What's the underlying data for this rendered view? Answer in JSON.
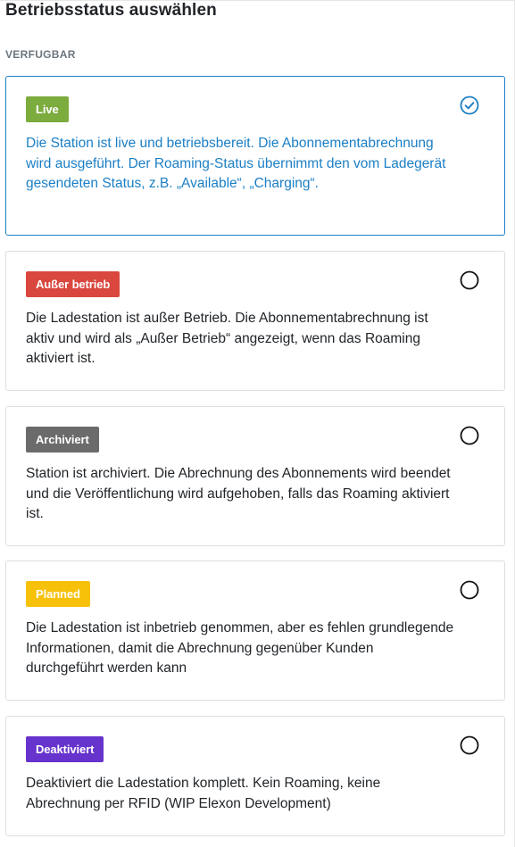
{
  "header": {
    "title": "Betriebsstatus auswählen",
    "section_label": "VERFUGBAR"
  },
  "colors": {
    "accent": "#1b7fc5",
    "live": "#7cab3e",
    "ausser_betrieb": "#d9473f",
    "archiviert": "#6b6b6b",
    "planned": "#f7c10a",
    "deaktiviert": "#6633cc"
  },
  "options": [
    {
      "badge": "Live",
      "selected": true,
      "description": "Die Station ist live und betriebsbereit. Die Abonnementabrechnung wird ausgeführt. Der Roaming-Status übernimmt den vom Ladegerät gesendeten Status, z.B. „Available“, „Charging“."
    },
    {
      "badge": "Außer betrieb",
      "selected": false,
      "description": "Die Ladestation ist außer Betrieb. Die Abonnementabrechnung ist aktiv und wird als „Außer Betrieb“ angezeigt, wenn das Roaming aktiviert ist."
    },
    {
      "badge": "Archiviert",
      "selected": false,
      "description": "Station ist archiviert. Die Abrechnung des Abonnements wird beendet und die Veröffentlichung wird aufgehoben, falls das Roaming aktiviert ist."
    },
    {
      "badge": "Planned",
      "selected": false,
      "description": "Die Ladestation ist inbetrieb genommen, aber es fehlen grundlegende Informationen, damit die Abrechnung gegenüber Kunden durchgeführt werden kann"
    },
    {
      "badge": "Deaktiviert",
      "selected": false,
      "description": "Deaktiviert die Ladestation komplett. Kein Roaming, keine Abrechnung per RFID (WIP Elexon Development)"
    }
  ]
}
